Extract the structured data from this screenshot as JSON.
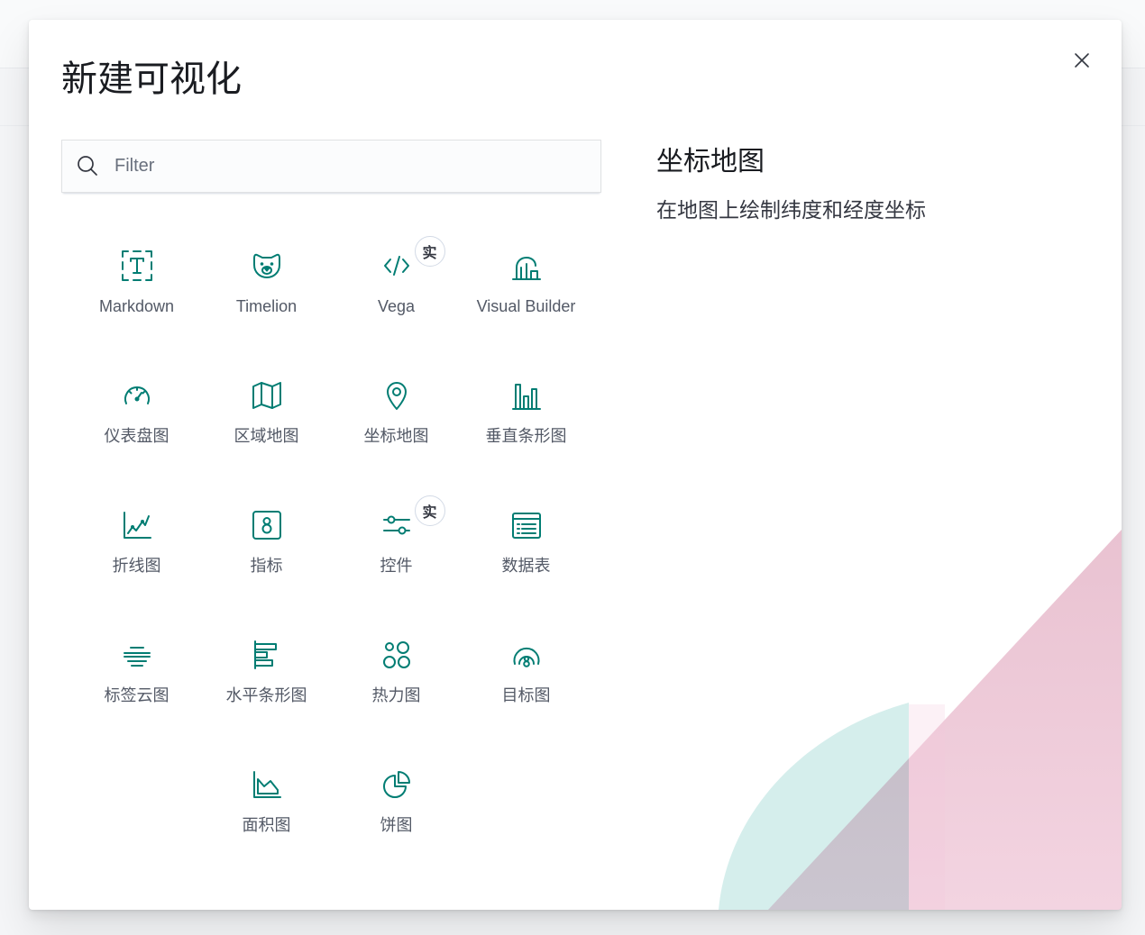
{
  "modal": {
    "title": "新建可视化",
    "close_icon": "cross-icon"
  },
  "search": {
    "placeholder": "Filter",
    "value": "",
    "icon": "search-icon"
  },
  "types": [
    {
      "label": "Markdown",
      "icon": "markdown-icon"
    },
    {
      "label": "Timelion",
      "icon": "timelion-icon"
    },
    {
      "label": "Vega",
      "icon": "vega-icon",
      "badge": "实"
    },
    {
      "label": "Visual Builder",
      "icon": "visual-builder-icon"
    },
    {
      "label": "仪表盘图",
      "icon": "gauge-icon"
    },
    {
      "label": "区域地图",
      "icon": "region-map-icon"
    },
    {
      "label": "坐标地图",
      "icon": "map-pin-icon"
    },
    {
      "label": "垂直条形图",
      "icon": "vertical-bar-icon"
    },
    {
      "label": "折线图",
      "icon": "line-chart-icon"
    },
    {
      "label": "指标",
      "icon": "metric-icon"
    },
    {
      "label": "控件",
      "icon": "controls-icon",
      "badge": "实"
    },
    {
      "label": "数据表",
      "icon": "data-table-icon"
    },
    {
      "label": "标签云图",
      "icon": "tag-cloud-icon"
    },
    {
      "label": "水平条形图",
      "icon": "horizontal-bar-icon"
    },
    {
      "label": "热力图",
      "icon": "heatmap-icon"
    },
    {
      "label": "目标图",
      "icon": "goal-icon"
    },
    {
      "label": "面积图",
      "icon": "area-chart-icon"
    },
    {
      "label": "饼图",
      "icon": "pie-chart-icon"
    }
  ],
  "description": {
    "title": "坐标地图",
    "text": "在地图上绘制纬度和经度坐标"
  },
  "colors": {
    "accent": "#017d73",
    "text": "#343741",
    "label": "#535966",
    "title": "#1a1c21"
  }
}
